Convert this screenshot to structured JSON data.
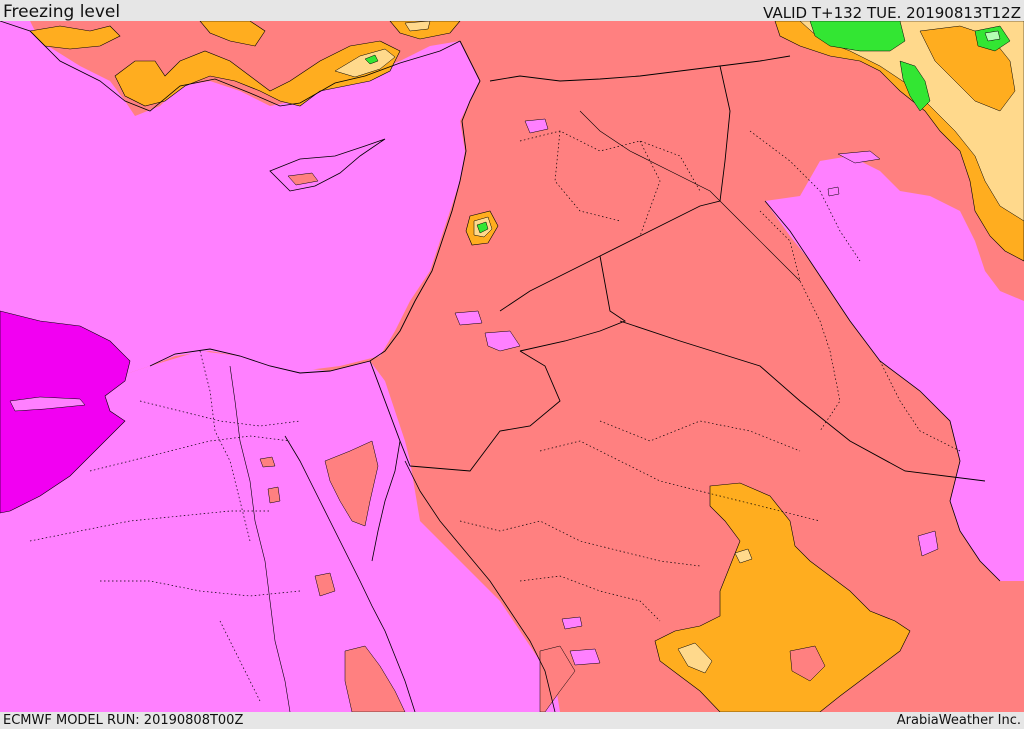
{
  "header": {
    "title": "Freezing level",
    "valid": "VALID T+132 TUE. 20190813T12Z"
  },
  "footer": {
    "model_run": "ECMWF MODEL RUN: 20190808T00Z",
    "credit": "ArabiaWeather Inc."
  },
  "colors": {
    "magenta_deep": "#f200f2",
    "violet": "#ff80ff",
    "salmon": "#ff8080",
    "orange": "#ffad1f",
    "light_orange": "#ffd98c",
    "green": "#33e633",
    "light_green": "#b3ffb3",
    "border": "#000000"
  }
}
